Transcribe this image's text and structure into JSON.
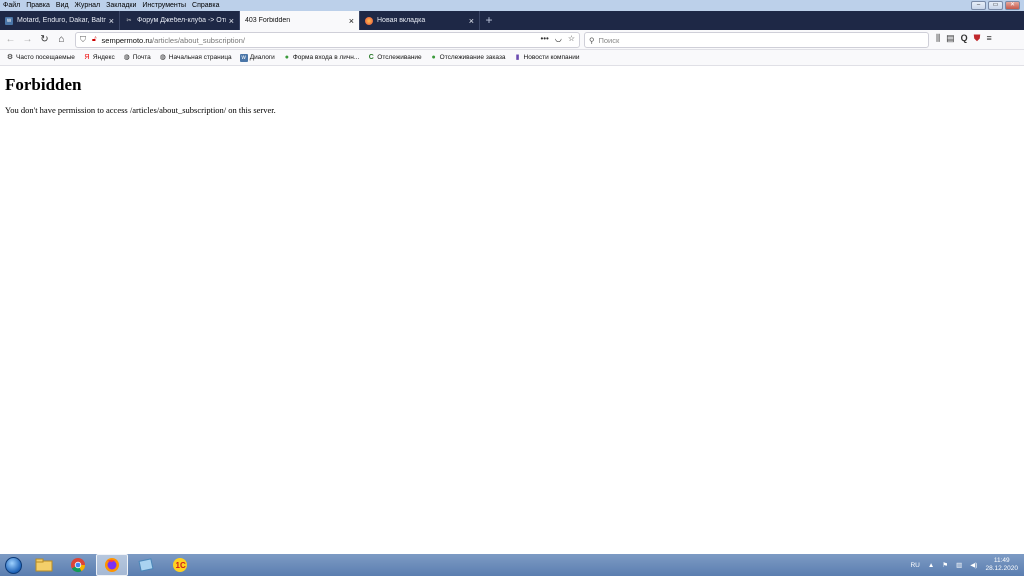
{
  "menu": [
    "Файл",
    "Правка",
    "Вид",
    "Журнал",
    "Закладки",
    "Инструменты",
    "Справка"
  ],
  "tabs": [
    {
      "title": "Motard, Enduro, Dakar, Baltmo",
      "icon": "vk-icon",
      "active": false
    },
    {
      "title": "Форум Джебел-клуба -> Отв",
      "icon": "scissors-icon",
      "active": false
    },
    {
      "title": "403 Forbidden",
      "icon": "",
      "active": true
    },
    {
      "title": "Новая вкладка",
      "icon": "firefox-icon",
      "active": false
    }
  ],
  "url": {
    "host": "sempermoto.ru",
    "path": "/articles/about_subscription/"
  },
  "search": {
    "placeholder": "Поиск"
  },
  "bookmarks": [
    {
      "label": "Часто посещаемые",
      "icon": "gear-icon"
    },
    {
      "label": "Яндекс",
      "icon": "yandex-icon"
    },
    {
      "label": "Почта",
      "icon": "globe-icon"
    },
    {
      "label": "Начальная страница",
      "icon": "globe-icon"
    },
    {
      "label": "Диалоги",
      "icon": "vk-icon"
    },
    {
      "label": "Форма входа в личн...",
      "icon": "green-circle-icon"
    },
    {
      "label": "Отслеживание",
      "icon": "c-icon"
    },
    {
      "label": "Отслеживание заказа",
      "icon": "green-circle-icon"
    },
    {
      "label": "Новости компании",
      "icon": "bar-icon"
    }
  ],
  "page": {
    "heading": "Forbidden",
    "message": "You don't have permission to access /articles/about_subscription/ on this server."
  },
  "tray": {
    "lang": "RU",
    "time": "11:49",
    "date": "28.12.2020"
  }
}
